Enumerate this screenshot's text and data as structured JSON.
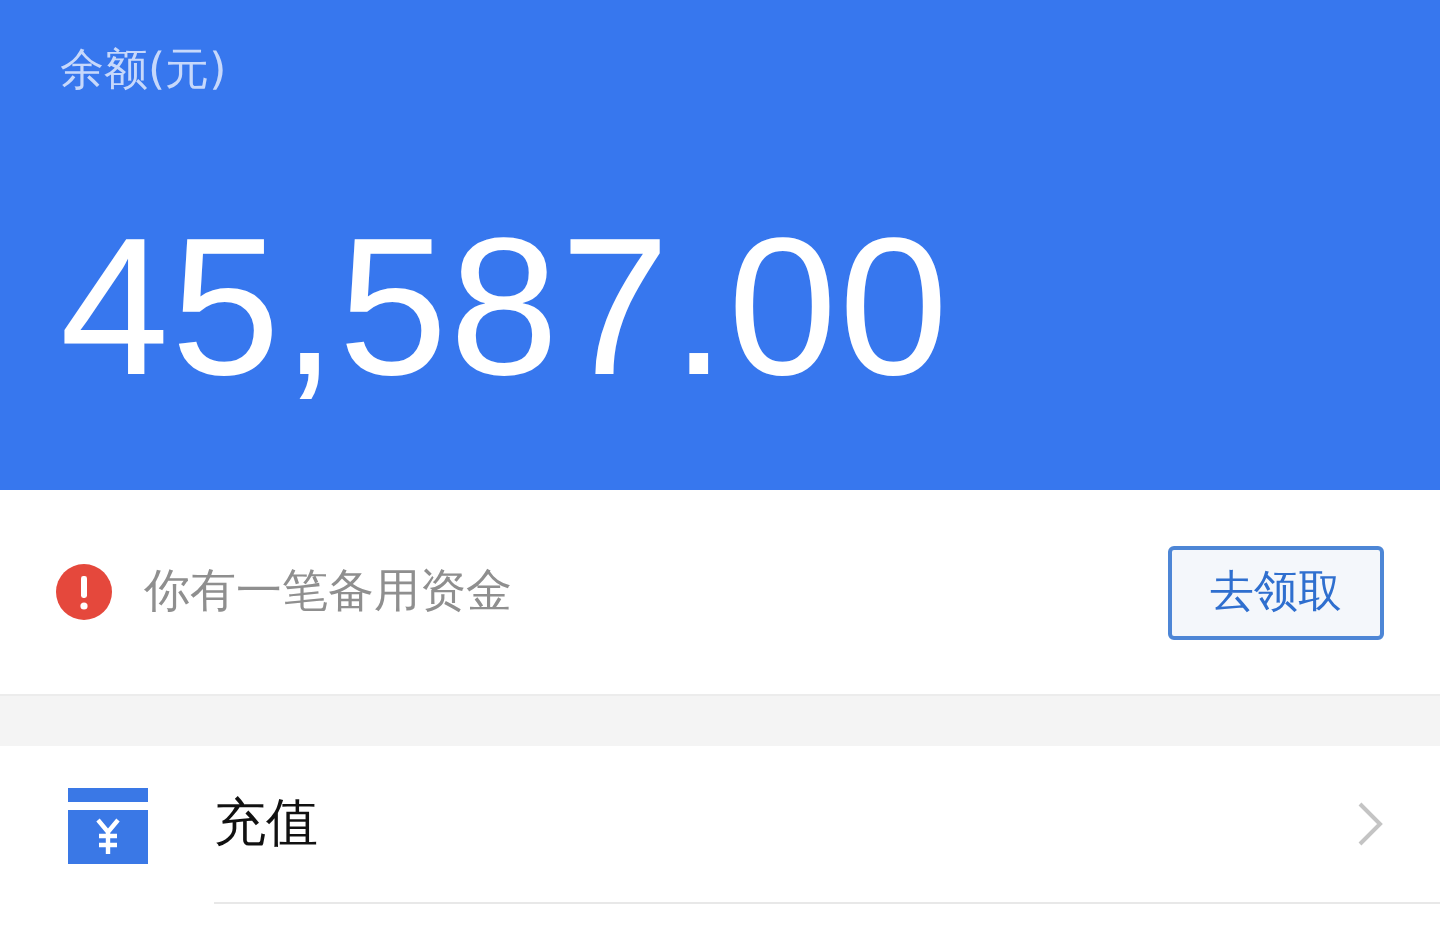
{
  "balance": {
    "label": "余额(元)",
    "amount": "45,587.00"
  },
  "notice": {
    "text": "你有一笔备用资金",
    "button": "去领取"
  },
  "menu": [
    {
      "label": "充值"
    }
  ]
}
